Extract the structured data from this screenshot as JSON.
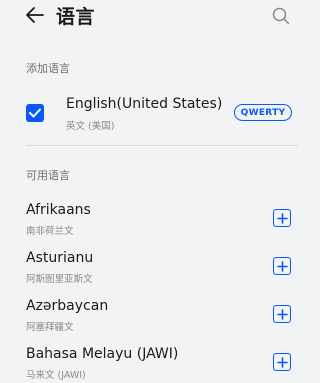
{
  "header": {
    "title": "语言",
    "back_icon": "arrow-left-icon",
    "search_icon": "search-icon"
  },
  "added_section": {
    "title": "添加语言",
    "items": [
      {
        "name": "English(United States)",
        "native": "英文 (美国)",
        "layout": "QWERTY",
        "checked": true
      }
    ]
  },
  "available_section": {
    "title": "可用语言",
    "items": [
      {
        "name": "Afrikaans",
        "native": "南非荷兰文"
      },
      {
        "name": "Asturianu",
        "native": "阿斯图里亚斯文"
      },
      {
        "name": "Azərbaycan",
        "native": "阿塞拜疆文"
      },
      {
        "name": "Bahasa Melayu (JAWI)",
        "native": "马来文 (JAWI)"
      }
    ]
  },
  "colors": {
    "accent": "#0a59f7",
    "background": "#f1f3f5"
  }
}
